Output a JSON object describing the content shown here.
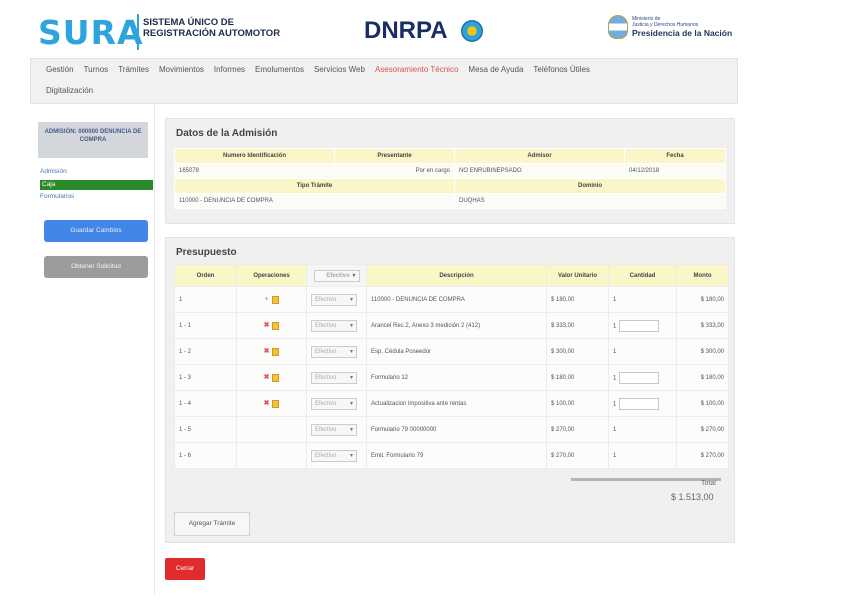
{
  "header": {
    "brand": "SURA",
    "subtitle_line1": "SISTEMA ÚNICO DE",
    "subtitle_line2": "REGISTRACIÓN AUTOMOTOR",
    "agency": "DNRPA",
    "ministry_line1": "Ministerio de",
    "ministry_line2": "Justicia y Derechos Humanos",
    "presidency": "Presidencia de la Nación"
  },
  "nav": {
    "items": [
      "Gestión",
      "Turnos",
      "Trámites",
      "Movimientos",
      "Informes",
      "Emolumentos",
      "Servicios Web",
      "Asesoramiento Técnico",
      "Mesa de Ayuda",
      "Teléfonos Útiles"
    ],
    "active_index": 7,
    "second_row": "Digitalización"
  },
  "sidebar": {
    "box_text": "ADMISIÓN: 000000 DENUNCIA DE COMPRA",
    "link_admission": "Admisión",
    "active_item": "Caja",
    "link_forms": "Formularios",
    "primary_button": "Guardar Cambios",
    "secondary_button": "Obtener Solicitud"
  },
  "admission": {
    "title": "Datos de la Admisión",
    "headers": [
      "Numero Identificación",
      "Presentante",
      "Admisor",
      "Fecha"
    ],
    "row": [
      "165078",
      "Por en cargo",
      "NO ENRUBINEPSADO",
      "04/12/2018"
    ],
    "headers2": [
      "Tipo Trámite",
      "Dominio"
    ],
    "row2": [
      "110000 - DENUNCIA DE COMPRA",
      "DUQHAS"
    ]
  },
  "budget": {
    "title": "Presupuesto",
    "headers": [
      "Orden",
      "Operaciones",
      "",
      "Descripción",
      "Valor Unitario",
      "Cantidad",
      "Monto"
    ],
    "header_select": "Efectivo",
    "rows": [
      {
        "orden": "1",
        "op": "plus",
        "select": "Efectivo",
        "descripcion": "110000 - DENUNCIA DE COMPRA",
        "valor": "$ 180,00",
        "cantidad": "1",
        "monto": "$ 180,00",
        "box": false
      },
      {
        "orden": "1 - 1",
        "op": "delete",
        "select": "Efectivo",
        "descripcion": "Arancel Rec.2, Anexo 3 medición 2 (412)",
        "valor": "$ 333,00",
        "cantidad": "1",
        "monto": "$ 333,00",
        "box": true
      },
      {
        "orden": "1 - 2",
        "op": "delete",
        "select": "Efectivo",
        "descripcion": "Esp. Cédula Poseedor",
        "valor": "$ 300,00",
        "cantidad": "1",
        "monto": "$ 300,00",
        "box": false
      },
      {
        "orden": "1 - 3",
        "op": "delete",
        "select": "Efectivo",
        "descripcion": "Formulario 12",
        "valor": "$ 180,00",
        "cantidad": "1",
        "monto": "$ 180,00",
        "box": true
      },
      {
        "orden": "1 - 4",
        "op": "delete",
        "select": "Efectivo",
        "descripcion": "Actualizacion impositiva ante rentas",
        "valor": "$ 100,00",
        "cantidad": "1",
        "monto": "$ 100,00",
        "box": true
      },
      {
        "orden": "1 - 5",
        "op": "none",
        "select": "Efectivo",
        "descripcion": "Formulario 79 00000000",
        "valor": "$ 270,00",
        "cantidad": "1",
        "monto": "$ 270,00",
        "box": false
      },
      {
        "orden": "1 - 6",
        "op": "none",
        "select": "Efectivo",
        "descripcion": "Emit. Formulario 79",
        "valor": "$ 270,00",
        "cantidad": "1",
        "monto": "$ 270,00",
        "box": false
      }
    ],
    "total_label": "Total",
    "total_value": "$ 1.513,00",
    "add_button": "Agregar Trámite"
  },
  "cancel_button": "Cerrar",
  "colors": {
    "sura_blue": "#2ea3dc",
    "active_nav": "#d9534f",
    "active_sidebar": "#2a8a2a",
    "primary": "#4286e8",
    "danger": "#e02c2c"
  }
}
